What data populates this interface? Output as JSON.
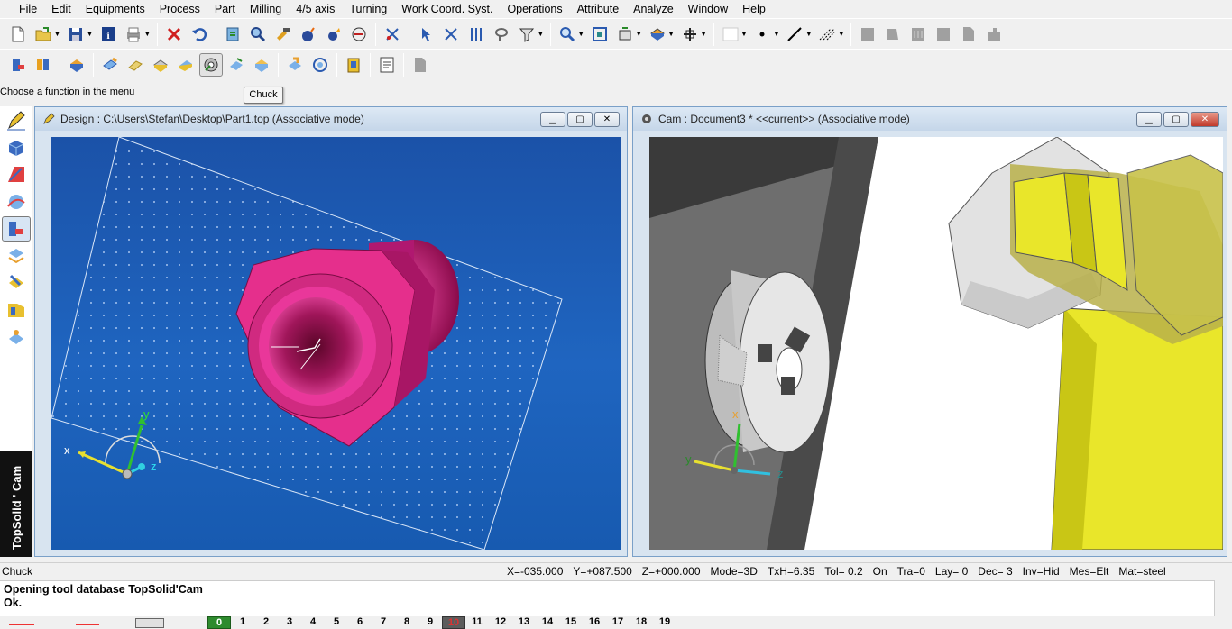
{
  "menu": [
    "File",
    "Edit",
    "Equipments",
    "Process",
    "Part",
    "Milling",
    "4/5 axis",
    "Turning",
    "Work Coord. Syst.",
    "Operations",
    "Attribute",
    "Analyze",
    "Window",
    "Help"
  ],
  "hint": "Choose a function in the menu",
  "tooltip": "Chuck",
  "brand": "TopSolid ' Cam",
  "design_window": {
    "title": "Design : C:\\Users\\Stefan\\Desktop\\Part1.top (Associative mode)",
    "axes": {
      "x": "x",
      "y": "y",
      "z": "z"
    }
  },
  "cam_window": {
    "title": "Cam : Document3 *  <<current>> (Associative mode)",
    "axes": {
      "y": "y",
      "x": "x",
      "z": "z"
    }
  },
  "status": {
    "left": "Chuck",
    "fields": [
      "X=-035.000",
      "Y=+087.500",
      "Z=+000.000",
      "Mode=3D",
      "TxH=6.35",
      "Tol=  0.2",
      "On",
      "Tra=0",
      "Lay=  0",
      "Dec= 3",
      "Inv=Hid",
      "Mes=Elt",
      "Mat=steel"
    ]
  },
  "console": [
    "Opening tool database TopSolid'Cam",
    "Ok."
  ],
  "layers": [
    "0",
    "1",
    "2",
    "3",
    "4",
    "5",
    "6",
    "7",
    "8",
    "9",
    "10",
    "11",
    "12",
    "13",
    "14",
    "15",
    "16",
    "17",
    "18",
    "19"
  ],
  "colors": {
    "design_bg": "#1d62b8",
    "part": "#e8258a",
    "cam_yellow": "#e9e62a",
    "chuck": "#d4d4d4"
  }
}
